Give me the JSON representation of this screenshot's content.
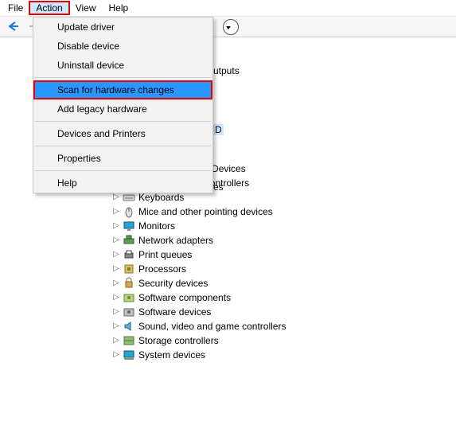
{
  "menubar": {
    "items": [
      "File",
      "Action",
      "View",
      "Help"
    ],
    "openIndex": 1
  },
  "dropdown": {
    "items": [
      {
        "label": "Update driver"
      },
      {
        "label": "Disable device"
      },
      {
        "label": "Uninstall device"
      },
      {
        "sep": true
      },
      {
        "label": "Scan for hardware changes",
        "highlight": true
      },
      {
        "label": "Add legacy hardware"
      },
      {
        "sep": true
      },
      {
        "label": "Devices and Printers"
      },
      {
        "sep": true
      },
      {
        "label": "Properties"
      },
      {
        "sep": true
      },
      {
        "label": "Help"
      }
    ]
  },
  "peek": {
    "r1": "utputs",
    "r2": "D",
    "r3": "es"
  },
  "tree": {
    "items": [
      {
        "label": "Human Interface Devices",
        "icon": "hid"
      },
      {
        "label": "IDE ATA/ATAPI controllers",
        "icon": "ide"
      },
      {
        "label": "Keyboards",
        "icon": "keyboard"
      },
      {
        "label": "Mice and other pointing devices",
        "icon": "mouse"
      },
      {
        "label": "Monitors",
        "icon": "monitor"
      },
      {
        "label": "Network adapters",
        "icon": "network"
      },
      {
        "label": "Print queues",
        "icon": "printer"
      },
      {
        "label": "Processors",
        "icon": "cpu"
      },
      {
        "label": "Security devices",
        "icon": "security"
      },
      {
        "label": "Software components",
        "icon": "swcomp"
      },
      {
        "label": "Software devices",
        "icon": "swdev"
      },
      {
        "label": "Sound, video and game controllers",
        "icon": "sound"
      },
      {
        "label": "Storage controllers",
        "icon": "storage"
      },
      {
        "label": "System devices",
        "icon": "system"
      }
    ]
  }
}
